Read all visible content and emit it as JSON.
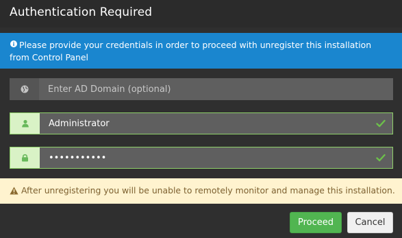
{
  "dialog": {
    "title": "Authentication Required"
  },
  "info_banner": {
    "icon": "info-icon",
    "text": "Please provide your credentials in order to proceed with unregister this installation from Control Panel",
    "color": "#1a86cf"
  },
  "fields": {
    "domain": {
      "icon": "globe-icon",
      "placeholder": "Enter AD Domain (optional)",
      "value": ""
    },
    "username": {
      "icon": "user-icon",
      "value": "Administrator",
      "valid": true
    },
    "password": {
      "icon": "lock-icon",
      "value": "•••••••••••",
      "valid": true
    }
  },
  "warning_banner": {
    "icon": "warning-icon",
    "text": "After unregistering you will be unable to remotely monitor and manage this installation.",
    "color": "#fff3cf"
  },
  "buttons": {
    "proceed_label": "Proceed",
    "cancel_label": "Cancel",
    "proceed_color": "#51b551"
  }
}
